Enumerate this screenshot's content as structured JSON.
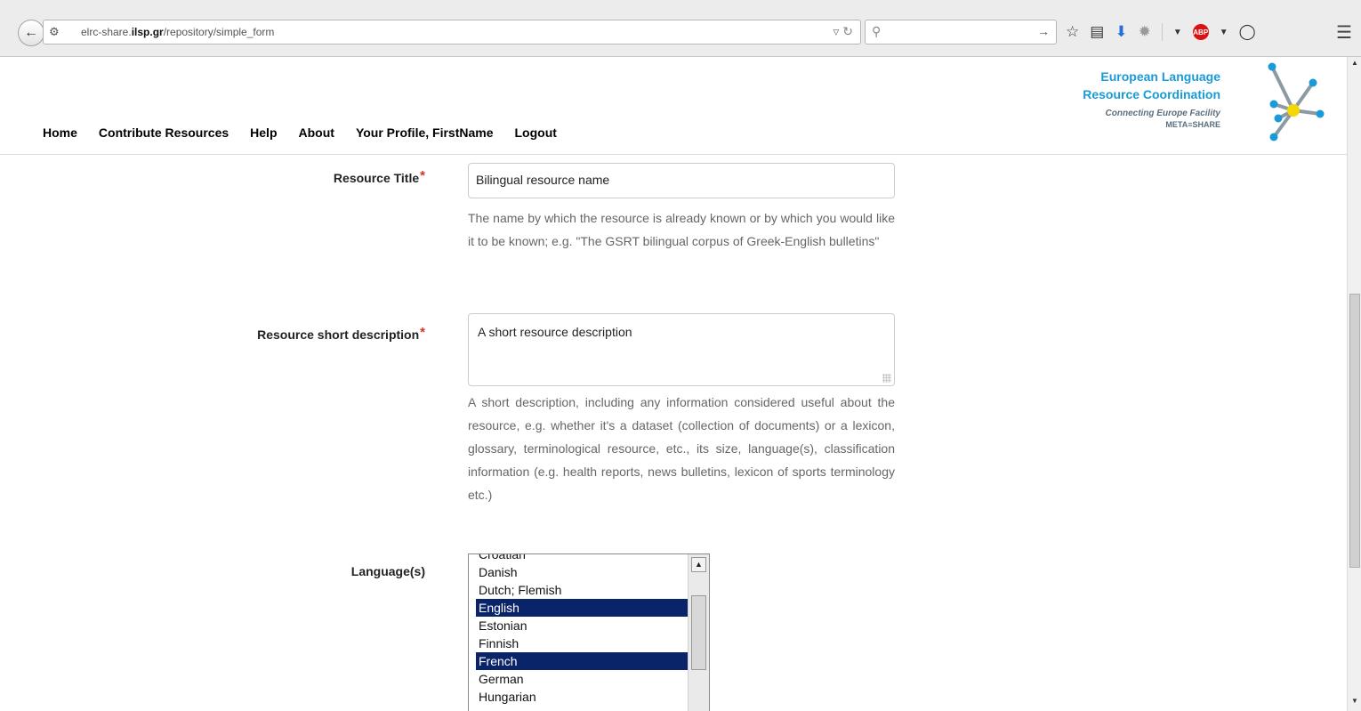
{
  "browser": {
    "url_prefix": "elrc-share.",
    "url_host_bold": "ilsp.gr",
    "url_path": "/repository/simple_form",
    "search_placeholder": "",
    "abp_label": "ABP"
  },
  "header": {
    "nav": [
      {
        "label": "Home"
      },
      {
        "label": "Contribute Resources"
      },
      {
        "label": "Help"
      },
      {
        "label": "About"
      },
      {
        "label": "Your Profile, FirstName"
      },
      {
        "label": "Logout"
      }
    ],
    "logo": {
      "line1": "European Language",
      "line2": "Resource Coordination",
      "line3": "Connecting Europe Facility",
      "line4": "META≡SHARE"
    }
  },
  "form": {
    "resource_title": {
      "label": "Resource Title",
      "required_mark": "*",
      "value": "Bilingual resource name",
      "help": "The name by which the resource is already known or by which you would like it to be known; e.g. \"The GSRT bilingual corpus of Greek-English bulletins\""
    },
    "short_description": {
      "label": "Resource short description",
      "required_mark": "*",
      "value": "A short resource description",
      "help": "A short description, including any information considered useful about the resource, e.g. whether it's a dataset (collection of documents) or a lexicon, glossary, terminological resource, etc., its size, language(s), classification information (e.g. health reports, news bulletins, lexicon of sports terminology etc.)"
    },
    "languages": {
      "label": "Language(s)",
      "options": [
        {
          "label": "Croatian",
          "selected": false
        },
        {
          "label": "Danish",
          "selected": false
        },
        {
          "label": "Dutch; Flemish",
          "selected": false
        },
        {
          "label": "English",
          "selected": true
        },
        {
          "label": "Estonian",
          "selected": false
        },
        {
          "label": "Finnish",
          "selected": false
        },
        {
          "label": "French",
          "selected": true
        },
        {
          "label": "German",
          "selected": false
        },
        {
          "label": "Hungarian",
          "selected": false
        }
      ]
    }
  },
  "colors": {
    "selected_option_bg": "#0a246a",
    "required_star": "#d2322d",
    "logo_blue": "#1a9ad6",
    "logo_yellow": "#f5d800"
  }
}
